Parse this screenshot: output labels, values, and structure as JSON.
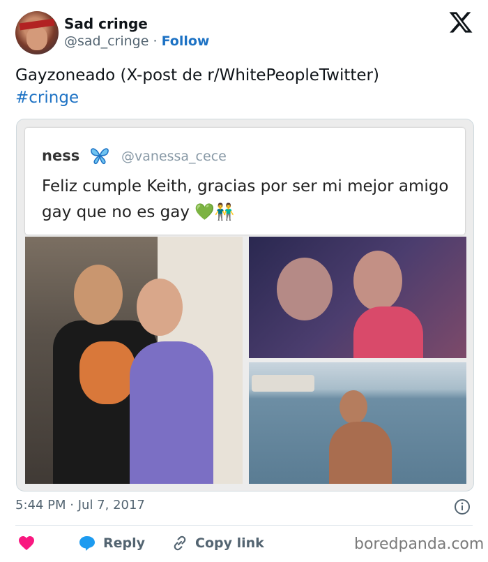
{
  "author": {
    "display_name": "Sad cringe",
    "handle": "@sad_cringe",
    "separator": "·",
    "follow_label": "Follow"
  },
  "tweet": {
    "text": "Gayzoneado (X-post de r/WhitePeopleTwitter)",
    "hashtag": "#cringe"
  },
  "embedded_tweet": {
    "name": "ness",
    "handle": "@vanessa_cece",
    "text": "Feliz cumple Keith, gracias por ser mi mejor amigo gay que no es gay 💚👬"
  },
  "meta": {
    "time": "5:44 PM",
    "separator": "·",
    "date": "Jul 7, 2017"
  },
  "actions": {
    "reply_label": "Reply",
    "copy_link_label": "Copy link"
  },
  "watermark": "boredpanda.com",
  "colors": {
    "like": "#f91880",
    "reply": "#1d9bf0",
    "link": "#1d72c4",
    "muted": "#536471"
  },
  "icons": [
    "x-logo-icon",
    "butterfly-icon",
    "info-icon",
    "heart-icon",
    "reply-bubble-icon",
    "link-icon"
  ]
}
